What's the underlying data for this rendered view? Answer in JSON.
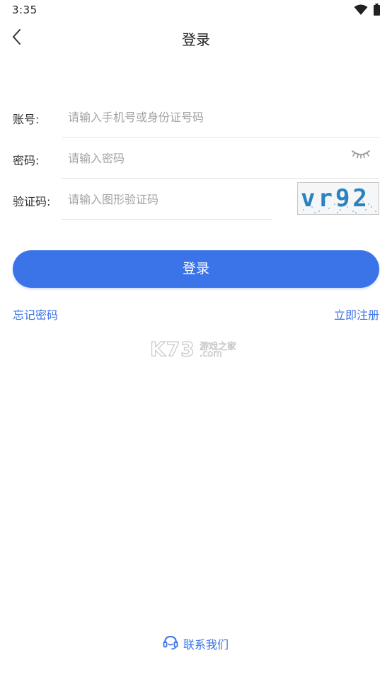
{
  "status_bar": {
    "time": "3:35",
    "icons": [
      "wifi-icon",
      "battery-icon"
    ]
  },
  "nav": {
    "title": "登录",
    "back_icon": "chevron-left-icon"
  },
  "form": {
    "account": {
      "label": "账号:",
      "placeholder": "请输入手机号或身份证号码",
      "value": ""
    },
    "password": {
      "label": "密码:",
      "placeholder": "请输入密码",
      "value": "",
      "toggle_icon": "eye-closed-icon"
    },
    "captcha": {
      "label": "验证码:",
      "placeholder": "请输入图形验证码",
      "value": "",
      "image_text": "vr92"
    }
  },
  "actions": {
    "login_label": "登录",
    "forgot_label": "忘记密码",
    "register_label": "立即注册"
  },
  "watermark": {
    "logo_text": "K73",
    "site_text": "游戏之家",
    "domain_text": ".com"
  },
  "contact": {
    "label": "联系我们",
    "icon": "headset-icon"
  },
  "colors": {
    "accent": "#3b73e8",
    "placeholder": "#a3a3a3",
    "divider": "#e6e6e6",
    "captcha_text": "#2a83bf"
  }
}
